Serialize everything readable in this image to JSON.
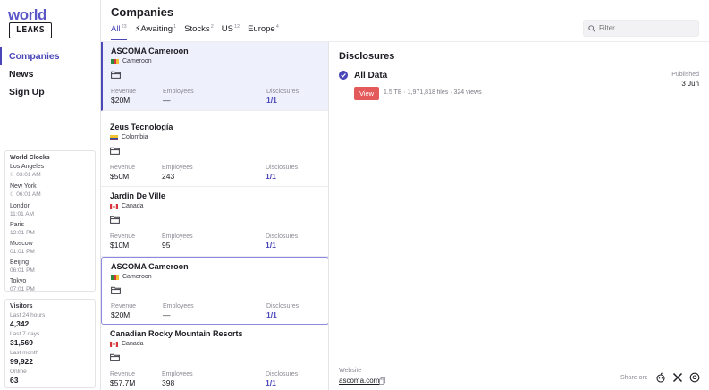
{
  "logo": {
    "line1": "world",
    "line2": "LEAKS"
  },
  "nav": [
    {
      "label": "Companies",
      "active": true
    },
    {
      "label": "News",
      "active": false
    },
    {
      "label": "Sign Up",
      "active": false
    }
  ],
  "clocks": {
    "title": "World Clocks",
    "items": [
      {
        "city": "Los Angeles",
        "time": "03:01 AM",
        "night": true
      },
      {
        "city": "New York",
        "time": "06:01 AM",
        "night": true
      },
      {
        "city": "London",
        "time": "11:01 AM",
        "night": false
      },
      {
        "city": "Paris",
        "time": "12:01 PM",
        "night": false
      },
      {
        "city": "Moscow",
        "time": "01:01 PM",
        "night": false
      },
      {
        "city": "Beijing",
        "time": "06:01 PM",
        "night": false
      },
      {
        "city": "Tokyo",
        "time": "07:01 PM",
        "night": false
      }
    ]
  },
  "visitors": {
    "title": "Visitors",
    "items": [
      {
        "label": "Last 24 hours",
        "value": "4,342"
      },
      {
        "label": "Last 7 days",
        "value": "31,569"
      },
      {
        "label": "Last month",
        "value": "99,922"
      },
      {
        "label": "Online",
        "value": "63"
      }
    ]
  },
  "header": {
    "title": "Companies",
    "filter_placeholder": "Filter",
    "tabs": [
      {
        "label": "All",
        "count": "23",
        "active": true
      },
      {
        "label": "⚡Awaiting",
        "count": "1",
        "active": false
      },
      {
        "label": "Stocks",
        "count": "2",
        "active": false
      },
      {
        "label": "US",
        "count": "12",
        "active": false
      },
      {
        "label": "Europe",
        "count": "4",
        "active": false
      }
    ]
  },
  "metric_labels": {
    "revenue": "Revenue",
    "employees": "Employees",
    "disclosures": "Disclosures"
  },
  "companies": [
    {
      "name": "ASCOMA Cameroon",
      "country": "Cameroon",
      "flag": "cameroon",
      "revenue": "$20M",
      "employees": "—",
      "disclosures": "1/1"
    },
    {
      "name": "Zeus Tecnología",
      "country": "Colombia",
      "flag": "colombia",
      "revenue": "$50M",
      "employees": "243",
      "disclosures": "1/1"
    },
    {
      "name": "Jardin De Ville",
      "country": "Canada",
      "flag": "canada",
      "revenue": "$10M",
      "employees": "95",
      "disclosures": "1/1"
    },
    {
      "name": "ASCOMA Cameroon",
      "country": "Cameroon",
      "flag": "cameroon",
      "revenue": "$20M",
      "employees": "—",
      "disclosures": "1/1"
    },
    {
      "name": "Canadian Rocky Mountain Resorts",
      "country": "Canada",
      "flag": "canada",
      "revenue": "$57.7M",
      "employees": "398",
      "disclosures": "1/1"
    }
  ],
  "detail": {
    "title": "Disclosures",
    "item_name": "All Data",
    "published_label": "Published",
    "published_date": "3 Jun",
    "view_label": "View",
    "meta": "1.5 TB  ·  1,971,818 files  ·  324 views",
    "website_label": "Website",
    "website": "ascoma.com",
    "share_label": "Share on:"
  },
  "colors": {
    "accent": "#4a47b8",
    "view_button": "#e45a5a"
  }
}
